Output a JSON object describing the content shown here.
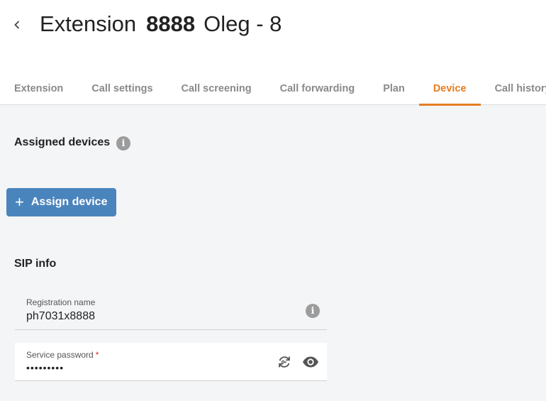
{
  "header": {
    "title_prefix": "Extension",
    "extension_number": "8888",
    "extension_name": "Oleg - 8"
  },
  "tabs": [
    {
      "label": "Extension"
    },
    {
      "label": "Call settings"
    },
    {
      "label": "Call screening"
    },
    {
      "label": "Call forwarding"
    },
    {
      "label": "Plan"
    },
    {
      "label": "Device"
    },
    {
      "label": "Call history"
    }
  ],
  "active_tab": "Device",
  "assigned_devices": {
    "title": "Assigned devices",
    "assign_button_label": "Assign device",
    "plus_glyph": "+"
  },
  "sip_info": {
    "title": "SIP info",
    "registration_name_label": "Registration name",
    "registration_name_value": "ph7031x8888",
    "service_password_label": "Service password",
    "required_marker": "*",
    "service_password_value": "•••••••••"
  },
  "icons": {
    "info": "i",
    "back": "chevron-left-icon",
    "regenerate": "regenerate-icon",
    "show_password": "eye-icon"
  },
  "colors": {
    "accent": "#e67e22",
    "primary_button": "#4a84bd",
    "info_icon": "#9c9c9c"
  }
}
